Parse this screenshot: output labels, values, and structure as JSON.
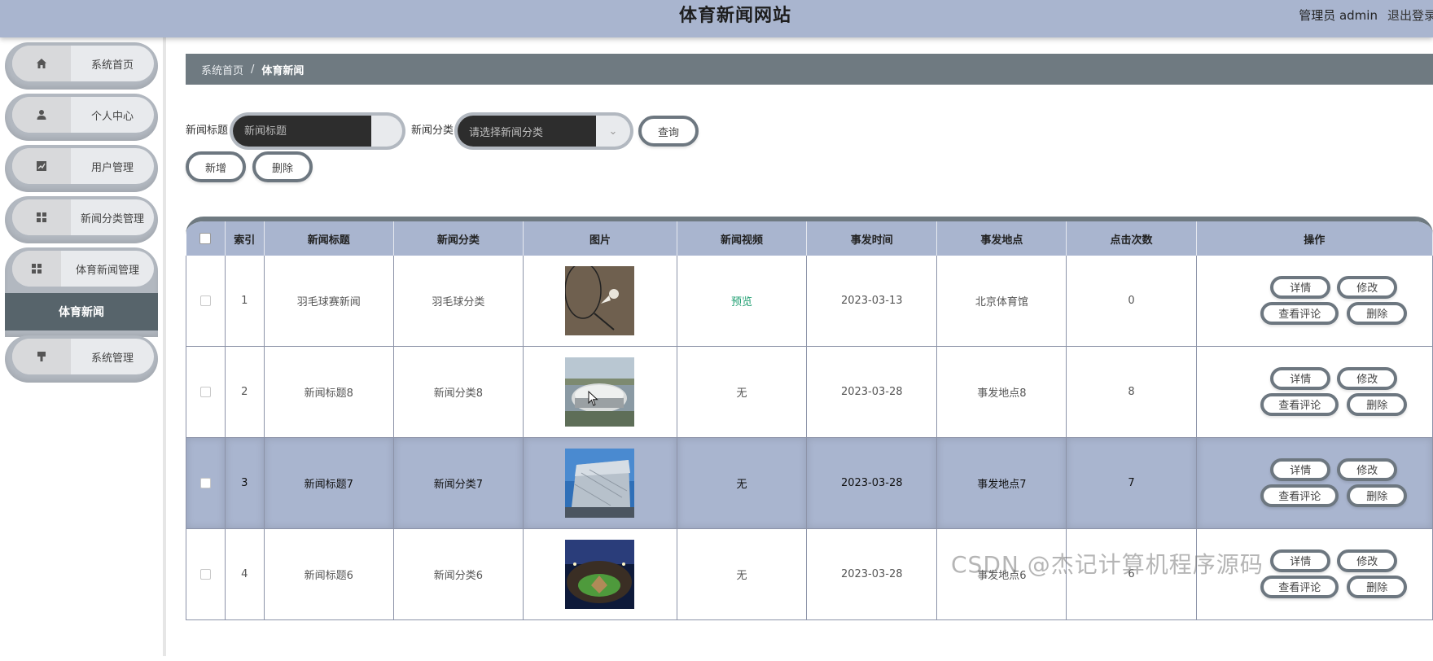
{
  "header": {
    "title": "体育新闻网站",
    "user_text": "管理员 admin",
    "logout": "退出登录"
  },
  "sidebar": {
    "items": [
      {
        "label": "系统首页",
        "icon": "home-icon"
      },
      {
        "label": "个人中心",
        "icon": "user-icon"
      },
      {
        "label": "用户管理",
        "icon": "chart-icon"
      },
      {
        "label": "新闻分类管理",
        "icon": "grid-icon"
      },
      {
        "label": "体育新闻管理",
        "icon": "grid-icon",
        "submenu": [
          "体育新闻"
        ]
      },
      {
        "label": "系统管理",
        "icon": "stamp-icon"
      }
    ]
  },
  "breadcrumb": {
    "home": "系统首页",
    "separator": "/",
    "current": "体育新闻"
  },
  "filters": {
    "title_label": "新闻标题",
    "title_placeholder": "新闻标题",
    "category_label": "新闻分类",
    "category_placeholder": "请选择新闻分类",
    "query_button": "查询"
  },
  "actions": {
    "add": "新增",
    "delete": "删除"
  },
  "table": {
    "columns": [
      "索引",
      "新闻标题",
      "新闻分类",
      "图片",
      "新闻视频",
      "事发时间",
      "事发地点",
      "点击次数",
      "操作"
    ],
    "rows": [
      {
        "index": "1",
        "title": "羽毛球赛新闻",
        "category": "羽毛球分类",
        "image": "badminton",
        "video": "预览",
        "time": "2023-03-13",
        "place": "北京体育馆",
        "clicks": "0"
      },
      {
        "index": "2",
        "title": "新闻标题8",
        "category": "新闻分类8",
        "image": "stadium-aerial",
        "video": "无",
        "time": "2023-03-28",
        "place": "事发地点8",
        "clicks": "8"
      },
      {
        "index": "3",
        "title": "新闻标题7",
        "category": "新闻分类7",
        "image": "modern-building",
        "video": "无",
        "time": "2023-03-28",
        "place": "事发地点7",
        "clicks": "7"
      },
      {
        "index": "4",
        "title": "新闻标题6",
        "category": "新闻分类6",
        "image": "night-stadium",
        "video": "无",
        "time": "2023-03-28",
        "place": "事发地点6",
        "clicks": "6"
      }
    ],
    "row_buttons": {
      "detail": "详情",
      "edit": "修改",
      "comments": "查看评论",
      "delete": "删除"
    }
  },
  "watermark": "CSDN @杰记计算机程序源码",
  "colors": {
    "header_bg": "#a9b5cf",
    "breadcrumb_bg": "#6f7a81",
    "submenu_bg": "#57646b",
    "highlight_row": "#a9b5cf",
    "preview_link": "#1e9e70"
  }
}
